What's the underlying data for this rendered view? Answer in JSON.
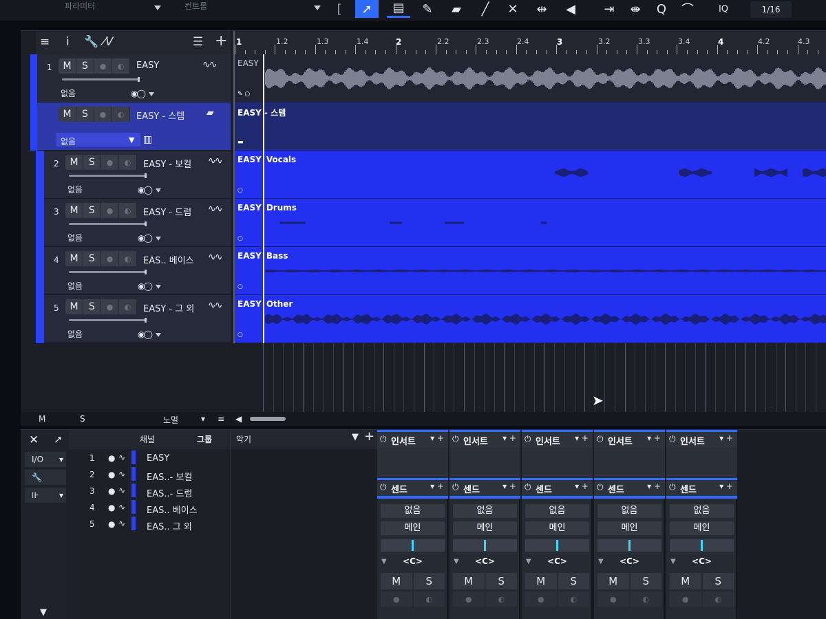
{
  "toolbar": {
    "dropdown_1": "파라미터",
    "dropdown_2": "컨트롤",
    "quantize": "1/16",
    "iq_label": "IQ"
  },
  "arrange": {
    "ruler": [
      {
        "label": "1",
        "major": true
      },
      {
        "label": "1.2",
        "major": false
      },
      {
        "label": "1.3",
        "major": false
      },
      {
        "label": "1.4",
        "major": false
      },
      {
        "label": "2",
        "major": true
      },
      {
        "label": "2.2",
        "major": false
      },
      {
        "label": "2.3",
        "major": false
      },
      {
        "label": "2.4",
        "major": false
      },
      {
        "label": "3",
        "major": true
      },
      {
        "label": "3.2",
        "major": false
      },
      {
        "label": "3.3",
        "major": false
      },
      {
        "label": "3.4",
        "major": false
      },
      {
        "label": "4",
        "major": true
      },
      {
        "label": "4.2",
        "major": false
      },
      {
        "label": "4.3",
        "major": false
      }
    ],
    "tracks": [
      {
        "num": "1",
        "name": "EASY",
        "mute": "M",
        "solo": "S",
        "input": "없음",
        "event": "EASY",
        "event_part": ""
      },
      {
        "num": "",
        "name": "EASY - 스템",
        "mute": "M",
        "solo": "S",
        "input": "없음",
        "event": "EASY - 스템",
        "event_part": ""
      },
      {
        "num": "2",
        "name": "EASY - 보컬",
        "mute": "M",
        "solo": "S",
        "input": "없음",
        "event": "EASY",
        "event_part": "Vocals"
      },
      {
        "num": "3",
        "name": "EASY - 드럼",
        "mute": "M",
        "solo": "S",
        "input": "없음",
        "event": "EASY",
        "event_part": "Drums"
      },
      {
        "num": "4",
        "name": "EAS.. 베이스",
        "mute": "M",
        "solo": "S",
        "input": "없음",
        "event": "EASY",
        "event_part": "Bass"
      },
      {
        "num": "5",
        "name": "EASY - 그 외",
        "mute": "M",
        "solo": "S",
        "input": "없음",
        "event": "EASY",
        "event_part": "Other"
      }
    ],
    "footer": {
      "m": "M",
      "s": "S",
      "mode": "노멀"
    }
  },
  "console": {
    "left": {
      "io": "I/O"
    },
    "tabs": {
      "channel": "채널",
      "group": "그룹",
      "instrument": "악기"
    },
    "channels": [
      {
        "num": "1",
        "name": "EASY"
      },
      {
        "num": "2",
        "name": "EAS..- 보컬"
      },
      {
        "num": "3",
        "name": "EAS..- 드럼"
      },
      {
        "num": "4",
        "name": "EAS.. 베이스"
      },
      {
        "num": "5",
        "name": "EAS.. 그 외"
      }
    ],
    "strip": {
      "insert_label": "인서트",
      "send_label": "센드",
      "input": "없음",
      "output": "메인",
      "pan": "<C>",
      "mute": "M",
      "solo": "S"
    }
  }
}
